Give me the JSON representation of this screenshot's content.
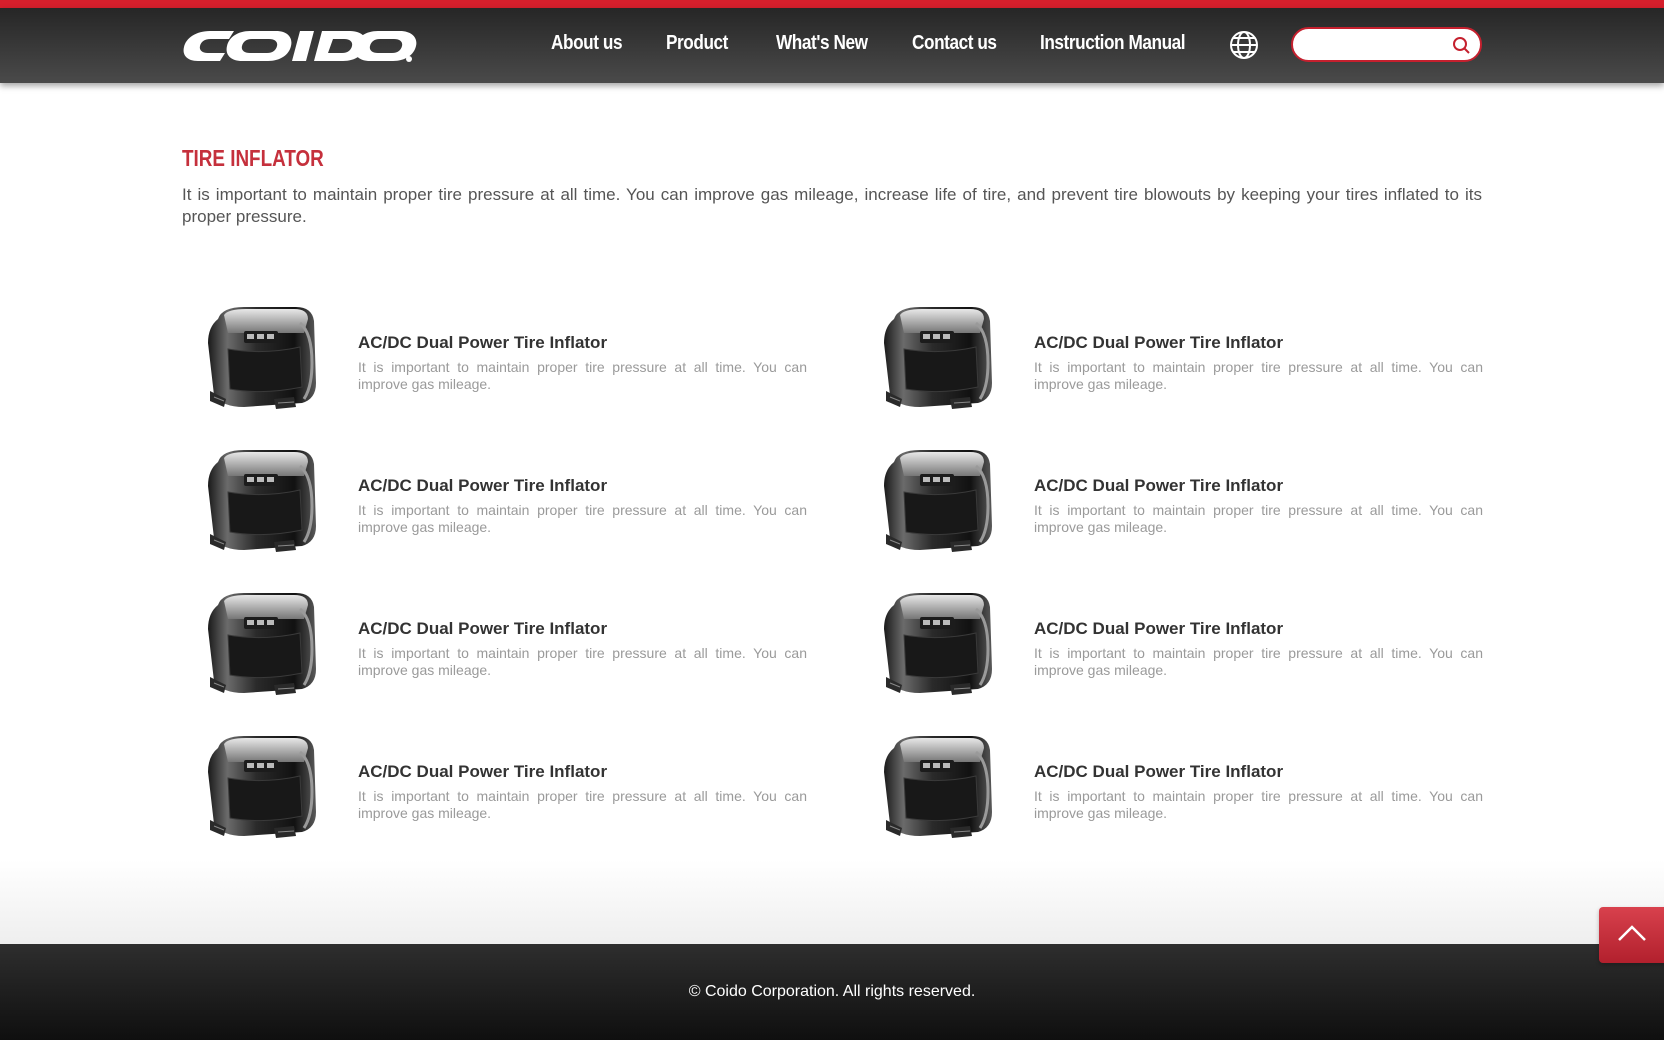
{
  "brand": {
    "logo_text": "COIDO",
    "accent_color": "#d61f2c"
  },
  "nav": {
    "items": [
      "About us",
      "Product",
      "What's New",
      "Contact us",
      "Instruction Manual"
    ],
    "language_icon": "globe-icon"
  },
  "search": {
    "placeholder": "",
    "value": "",
    "icon": "search-icon"
  },
  "page": {
    "title": "TIRE INFLATOR",
    "intro": "It is important to maintain proper tire pressure at all time. You can improve gas mileage, increase life of tire, and prevent tire blowouts by keeping your tires inflated to its proper pressure."
  },
  "products": [
    {
      "name": "AC/DC Dual Power Tire Inflator",
      "desc": "It is important to maintain proper tire pressure at all time. You can improve gas mileage."
    },
    {
      "name": "AC/DC Dual Power Tire Inflator",
      "desc": "It is important to maintain proper tire pressure at all time. You can improve gas mileage."
    },
    {
      "name": "AC/DC Dual Power Tire Inflator",
      "desc": "It is important to maintain proper tire pressure at all time. You can improve gas mileage."
    },
    {
      "name": "AC/DC Dual Power Tire Inflator",
      "desc": "It is important to maintain proper tire pressure at all time. You can improve gas mileage."
    },
    {
      "name": "AC/DC Dual Power Tire Inflator",
      "desc": "It is important to maintain proper tire pressure at all time. You can improve gas mileage."
    },
    {
      "name": "AC/DC Dual Power Tire Inflator",
      "desc": "It is important to maintain proper tire pressure at all time. You can improve gas mileage."
    },
    {
      "name": "AC/DC Dual Power Tire Inflator",
      "desc": "It is important to maintain proper tire pressure at all time. You can improve gas mileage."
    },
    {
      "name": "AC/DC Dual Power Tire Inflator",
      "desc": "It is important to maintain proper tire pressure at all time. You can improve gas mileage."
    }
  ],
  "footer": {
    "copyright": "© Coido Corporation. All rights reserved."
  },
  "back_to_top": {
    "icon": "chevron-up-icon"
  }
}
